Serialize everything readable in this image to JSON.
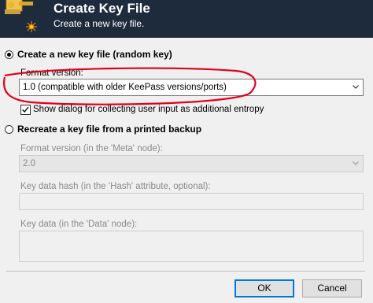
{
  "banner": {
    "title": "Create Key File",
    "subtitle": "Create a new key file.",
    "icon": "key-file-icon"
  },
  "create_option": {
    "label": "Create a new key file (random key)",
    "selected": true,
    "format_label": "Format version:",
    "format_value": "1.0 (compatible with older KeePass versions/ports)",
    "entropy_checkbox_label": "Show dialog for collecting user input as additional entropy",
    "entropy_checked": true
  },
  "recreate_option": {
    "label": "Recreate a key file from a printed backup",
    "selected": false,
    "format_label": "Format version (in the 'Meta' node):",
    "format_value": "2.0",
    "hash_label": "Key data hash (in the 'Hash' attribute, optional):",
    "hash_value": "",
    "data_label": "Key data (in the 'Data' node):",
    "data_value": ""
  },
  "buttons": {
    "ok": "OK",
    "cancel": "Cancel"
  },
  "annotation": {
    "color": "#e0001b",
    "shape": "hand-drawn ellipse"
  }
}
